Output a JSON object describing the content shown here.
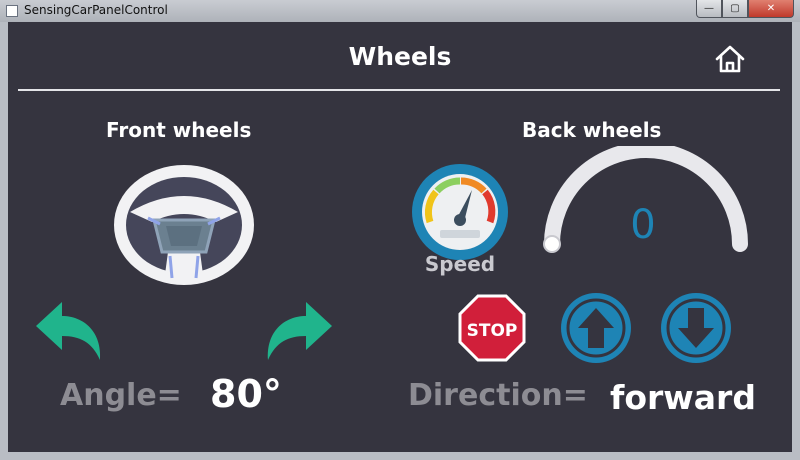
{
  "window": {
    "title": "SensingCarPanelControl",
    "minimize": "—",
    "maximize": "▢",
    "close": "✕"
  },
  "header": {
    "title": "Wheels",
    "home_icon": "home-icon"
  },
  "front": {
    "title": "Front wheels",
    "angle_label": "Angle=",
    "angle_value": "80°"
  },
  "back": {
    "title": "Back wheels",
    "speed_label": "Speed",
    "speed_value": "0",
    "speed_level": 0,
    "direction_label": "Direction=",
    "direction_value": "forward",
    "stop_label": "STOP"
  },
  "colors": {
    "background": "#35343f",
    "accent_blue": "#1e84b5",
    "arrow_green": "#20b48c",
    "stop_red": "#d11f3a"
  }
}
